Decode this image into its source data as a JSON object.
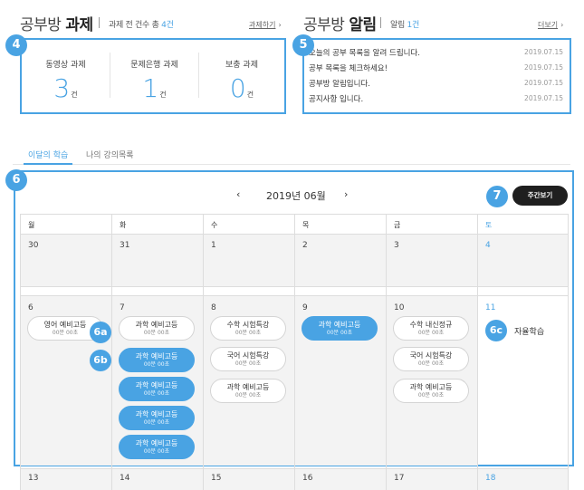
{
  "homework": {
    "title_prefix": "공부방",
    "title_bold": "과제",
    "summary_prefix": "과제 전 건수 총",
    "summary_count": "4건",
    "link": "과제하기",
    "items": [
      {
        "label": "동영상 과제",
        "count": "3",
        "unit": "건"
      },
      {
        "label": "문제은행 과제",
        "count": "1",
        "unit": "건"
      },
      {
        "label": "보충 과제",
        "count": "0",
        "unit": "건"
      }
    ]
  },
  "notice": {
    "title_prefix": "공부방",
    "title_bold": "알림",
    "summary_prefix": "알림",
    "summary_count": "1건",
    "link": "더보기",
    "items": [
      {
        "text": "오늘의 공부 목록을 알려 드립니다.",
        "date": "2019.07.15"
      },
      {
        "text": "공부 목록을 체크하세요!",
        "date": "2019.07.15"
      },
      {
        "text": "공부방 알림입니다.",
        "date": "2019.07.15"
      },
      {
        "text": "공지사항 입니다.",
        "date": "2019.07.15"
      }
    ]
  },
  "tabs": [
    {
      "label": "이달의 학습",
      "active": true
    },
    {
      "label": "나의 강의목록",
      "active": false
    }
  ],
  "calendar": {
    "month_label": "2019년 06월",
    "prev_icon": "chevron-left-icon",
    "next_icon": "chevron-right-icon",
    "week_view_button": "주간보기",
    "weekdays": [
      "월",
      "화",
      "수",
      "목",
      "금",
      "토"
    ],
    "week1_dates": [
      "30",
      "31",
      "1",
      "2",
      "3",
      "4"
    ],
    "week2_dates": [
      "6",
      "7",
      "8",
      "9",
      "10",
      "11"
    ],
    "week3_dates": [
      "13",
      "14",
      "15",
      "16",
      "17",
      "18"
    ],
    "mon_events": [
      {
        "title": "영어 예비고등",
        "time": "00분 00초"
      }
    ],
    "tue_events": [
      {
        "title": "과학 예비고등",
        "time": "00분 00초"
      },
      {
        "title": "과학 예비고등",
        "time": "00분 00초"
      },
      {
        "title": "과학 예비고등",
        "time": "00분 00초"
      },
      {
        "title": "과학 예비고등",
        "time": "00분 00초"
      },
      {
        "title": "과학 예비고등",
        "time": "00분 00초"
      }
    ],
    "wed_events": [
      {
        "title": "수학 시험특강",
        "time": "00분 00초"
      },
      {
        "title": "국어 시험특강",
        "time": "00분 00초"
      },
      {
        "title": "과학 예비고등",
        "time": "00분 00초"
      }
    ],
    "thu_events": [
      {
        "title": "과학 예비고등",
        "time": "00분 00초"
      }
    ],
    "fri_events": [
      {
        "title": "수학 내신정규",
        "time": "00분 00초"
      },
      {
        "title": "국어 시험특강",
        "time": "00분 00초"
      },
      {
        "title": "과학 예비고등",
        "time": "00분 00초"
      }
    ],
    "sat_note": "자율학습"
  },
  "badges": [
    "4",
    "5",
    "6",
    "7",
    "6a",
    "6b",
    "6c"
  ],
  "colors": {
    "accent": "#49a3e3",
    "dark_button": "#1f1f1f"
  }
}
